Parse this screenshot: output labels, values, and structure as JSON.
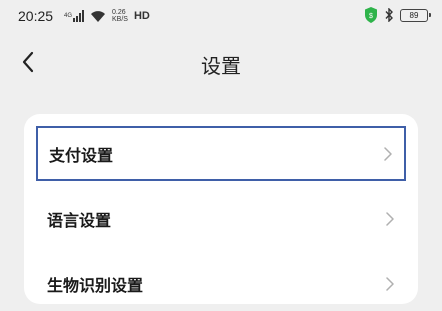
{
  "status_bar": {
    "time": "20:25",
    "signal": "4G",
    "net_speed_value": "0.26",
    "net_speed_unit": "KB/S",
    "hd_label": "HD",
    "battery_level": "89",
    "icons": [
      "signal-icon",
      "wifi-icon",
      "shield-icon",
      "bluetooth-icon",
      "battery-icon"
    ],
    "shield_color": "#2eb34a"
  },
  "nav": {
    "title": "设置",
    "back_icon": "chevron-left-icon"
  },
  "settings": {
    "items": [
      {
        "label": "支付设置",
        "focused": true
      },
      {
        "label": "语言设置",
        "focused": false
      },
      {
        "label": "生物识别设置",
        "focused": false
      }
    ]
  },
  "colors": {
    "background": "#efefef",
    "card": "#ffffff",
    "focus_border": "#3f5fa8",
    "chevron": "#b0b0b0"
  }
}
